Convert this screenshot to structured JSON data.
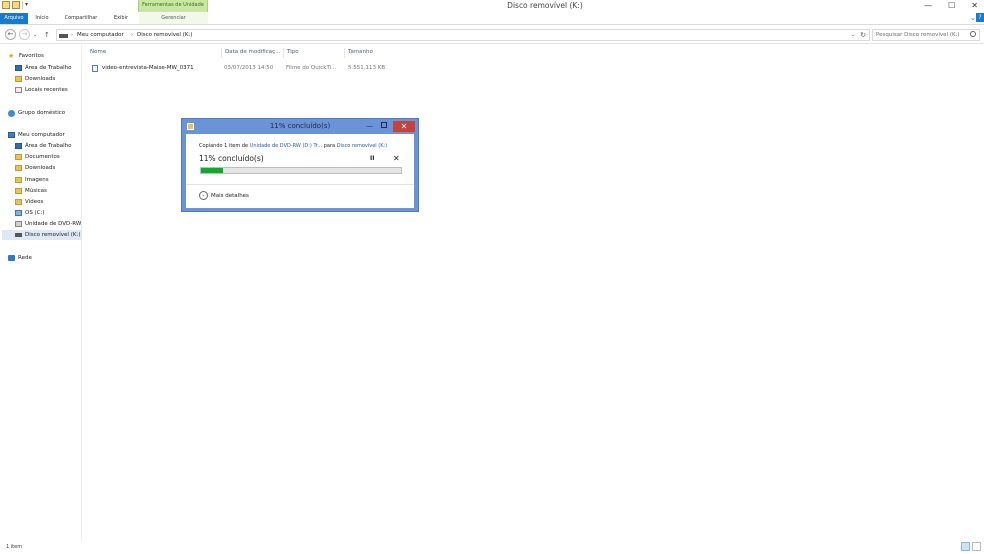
{
  "titlebar": {
    "context_group": "Ferramentas de Unidade",
    "title": "Disco removível (K:)",
    "minimize": "—",
    "maximize": "☐",
    "close": "✕"
  },
  "ribbon": {
    "tabs": [
      "Arquivo",
      "Início",
      "Compartilhar",
      "Exibir"
    ],
    "context_tab": "Gerenciar",
    "expand": "⌄",
    "help": "?"
  },
  "address": {
    "back": "←",
    "forward": "→",
    "recent": "⌄",
    "up": "↑",
    "separator": "›",
    "crumbs": [
      "Meu computador",
      "Disco removível (K:)"
    ],
    "dropdown": "⌄",
    "refresh": "↻",
    "search_placeholder": "Pesquisar Disco removível (K:)"
  },
  "nav": {
    "favorites": {
      "label": "Favoritos",
      "items": [
        "Área de Trabalho",
        "Downloads",
        "Locais recentes"
      ]
    },
    "homegroup": "Grupo doméstico",
    "computer": {
      "label": "Meu computador",
      "items": [
        "Área de Trabalho",
        "Documentos",
        "Downloads",
        "Imagens",
        "Músicas",
        "Vídeos",
        "OS (C:)",
        "Unidade de DVD-RW",
        "Disco removível (K:)"
      ]
    },
    "network": "Rede"
  },
  "columns": {
    "name": "Nome",
    "date": "Data de modificaç...",
    "type": "Tipo",
    "size": "Tamanho"
  },
  "files": [
    {
      "name": "video-entrevista-Maise-MW_0371",
      "date": "03/07/2013 14:50",
      "type": "Filme do QuickTi...",
      "size": "5.551.113 KB"
    }
  ],
  "status": {
    "items": "1 item"
  },
  "dialog": {
    "title": "11% concluído(s)",
    "minimize": "—",
    "close": "✕",
    "desc_prefix": "Copiando 1 item de ",
    "source": "Unidade de DVD-RW (D:) Tr...",
    "desc_mid": " para ",
    "dest": "Disco removível (K:)",
    "percent_label": "11% concluído(s)",
    "pause": "II",
    "cancel": "✕",
    "progress": 0.11,
    "more_icon": "⌄",
    "more": "Mais detalhes"
  }
}
